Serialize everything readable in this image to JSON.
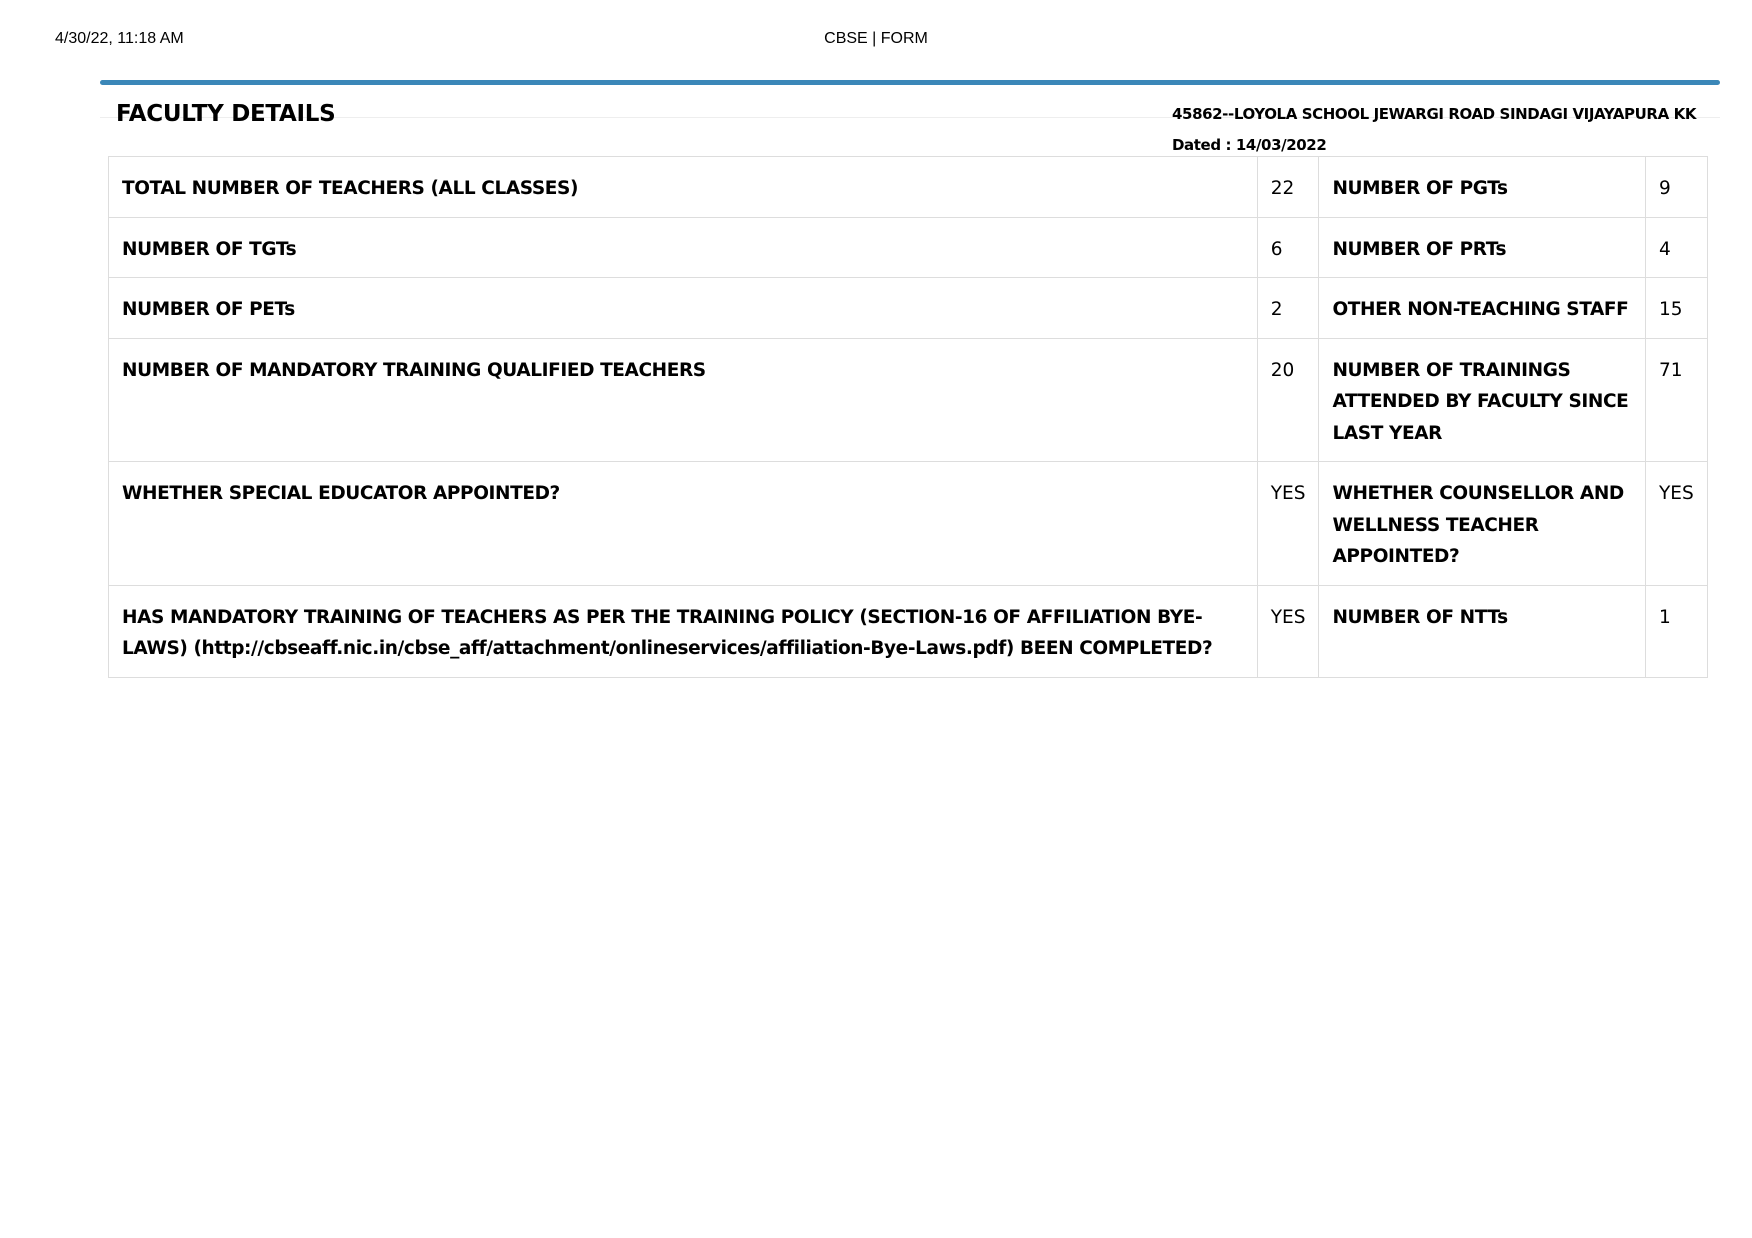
{
  "print_header": {
    "timestamp": "4/30/22, 11:18 AM",
    "title": "CBSE | FORM"
  },
  "panel": {
    "title": "FACULTY DETAILS",
    "school_name": "45862--LOYOLA SCHOOL JEWARGI ROAD SINDAGI VIJAYAPURA KK",
    "dated": "Dated : 14/03/2022",
    "accent_color": "#3b87b8"
  },
  "rows": [
    {
      "label1": "TOTAL NUMBER OF TEACHERS (ALL CLASSES)",
      "value1": "22",
      "label2": "NUMBER OF PGTs",
      "value2": "9"
    },
    {
      "label1": "NUMBER OF TGTs",
      "value1": "6",
      "label2": "NUMBER OF PRTs",
      "value2": "4"
    },
    {
      "label1": "NUMBER OF PETs",
      "value1": "2",
      "label2": "OTHER NON-TEACHING STAFF",
      "value2": "15"
    },
    {
      "label1": "NUMBER OF MANDATORY TRAINING QUALIFIED TEACHERS",
      "value1": "20",
      "label2": "NUMBER OF TRAININGS ATTENDED BY FACULTY SINCE LAST YEAR",
      "value2": "71"
    },
    {
      "label1": "WHETHER SPECIAL EDUCATOR APPOINTED?",
      "value1": "YES",
      "label2": "WHETHER COUNSELLOR AND WELLNESS TEACHER APPOINTED?",
      "value2": "YES"
    },
    {
      "label1": "HAS MANDATORY TRAINING OF TEACHERS AS PER THE TRAINING POLICY (SECTION-16 OF AFFILIATION BYE-LAWS) (http://cbseaff.nic.in/cbse_aff/attachment/onlineservices/affiliation-Bye-Laws.pdf) BEEN COMPLETED?",
      "value1": "YES",
      "label2": "NUMBER OF NTTs",
      "value2": "1"
    }
  ]
}
